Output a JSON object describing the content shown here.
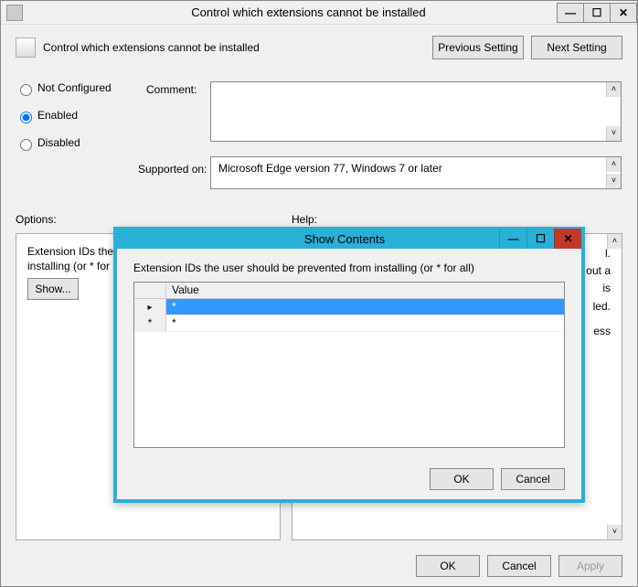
{
  "window": {
    "title": "Control which extensions cannot be installed",
    "header_text": "Control which extensions cannot be installed"
  },
  "nav": {
    "prev": "Previous Setting",
    "next": "Next Setting"
  },
  "radios": {
    "not_configured": "Not Configured",
    "enabled": "Enabled",
    "disabled": "Disabled",
    "selected": "enabled"
  },
  "labels": {
    "comment": "Comment:",
    "supported_on": "Supported on:",
    "options": "Options:",
    "help": "Help:"
  },
  "supported_on": "Microsoft Edge version 77, Windows 7 or later",
  "options_panel": {
    "line1": "Extension IDs the us",
    "line2": "installing (or * for all",
    "show_button": "Show..."
  },
  "help_panel": {
    "frag1": "l.",
    "frag2": "out a",
    "frag3": "is",
    "frag4": "led.",
    "frag5": "ess"
  },
  "main_buttons": {
    "ok": "OK",
    "cancel": "Cancel",
    "apply": "Apply"
  },
  "modal": {
    "title": "Show Contents",
    "description": "Extension IDs the user should be prevented from installing (or * for all)",
    "column_header": "Value",
    "rows": [
      {
        "value": "*",
        "selected": true
      },
      {
        "value": "*",
        "selected": false
      }
    ],
    "ok": "OK",
    "cancel": "Cancel"
  }
}
